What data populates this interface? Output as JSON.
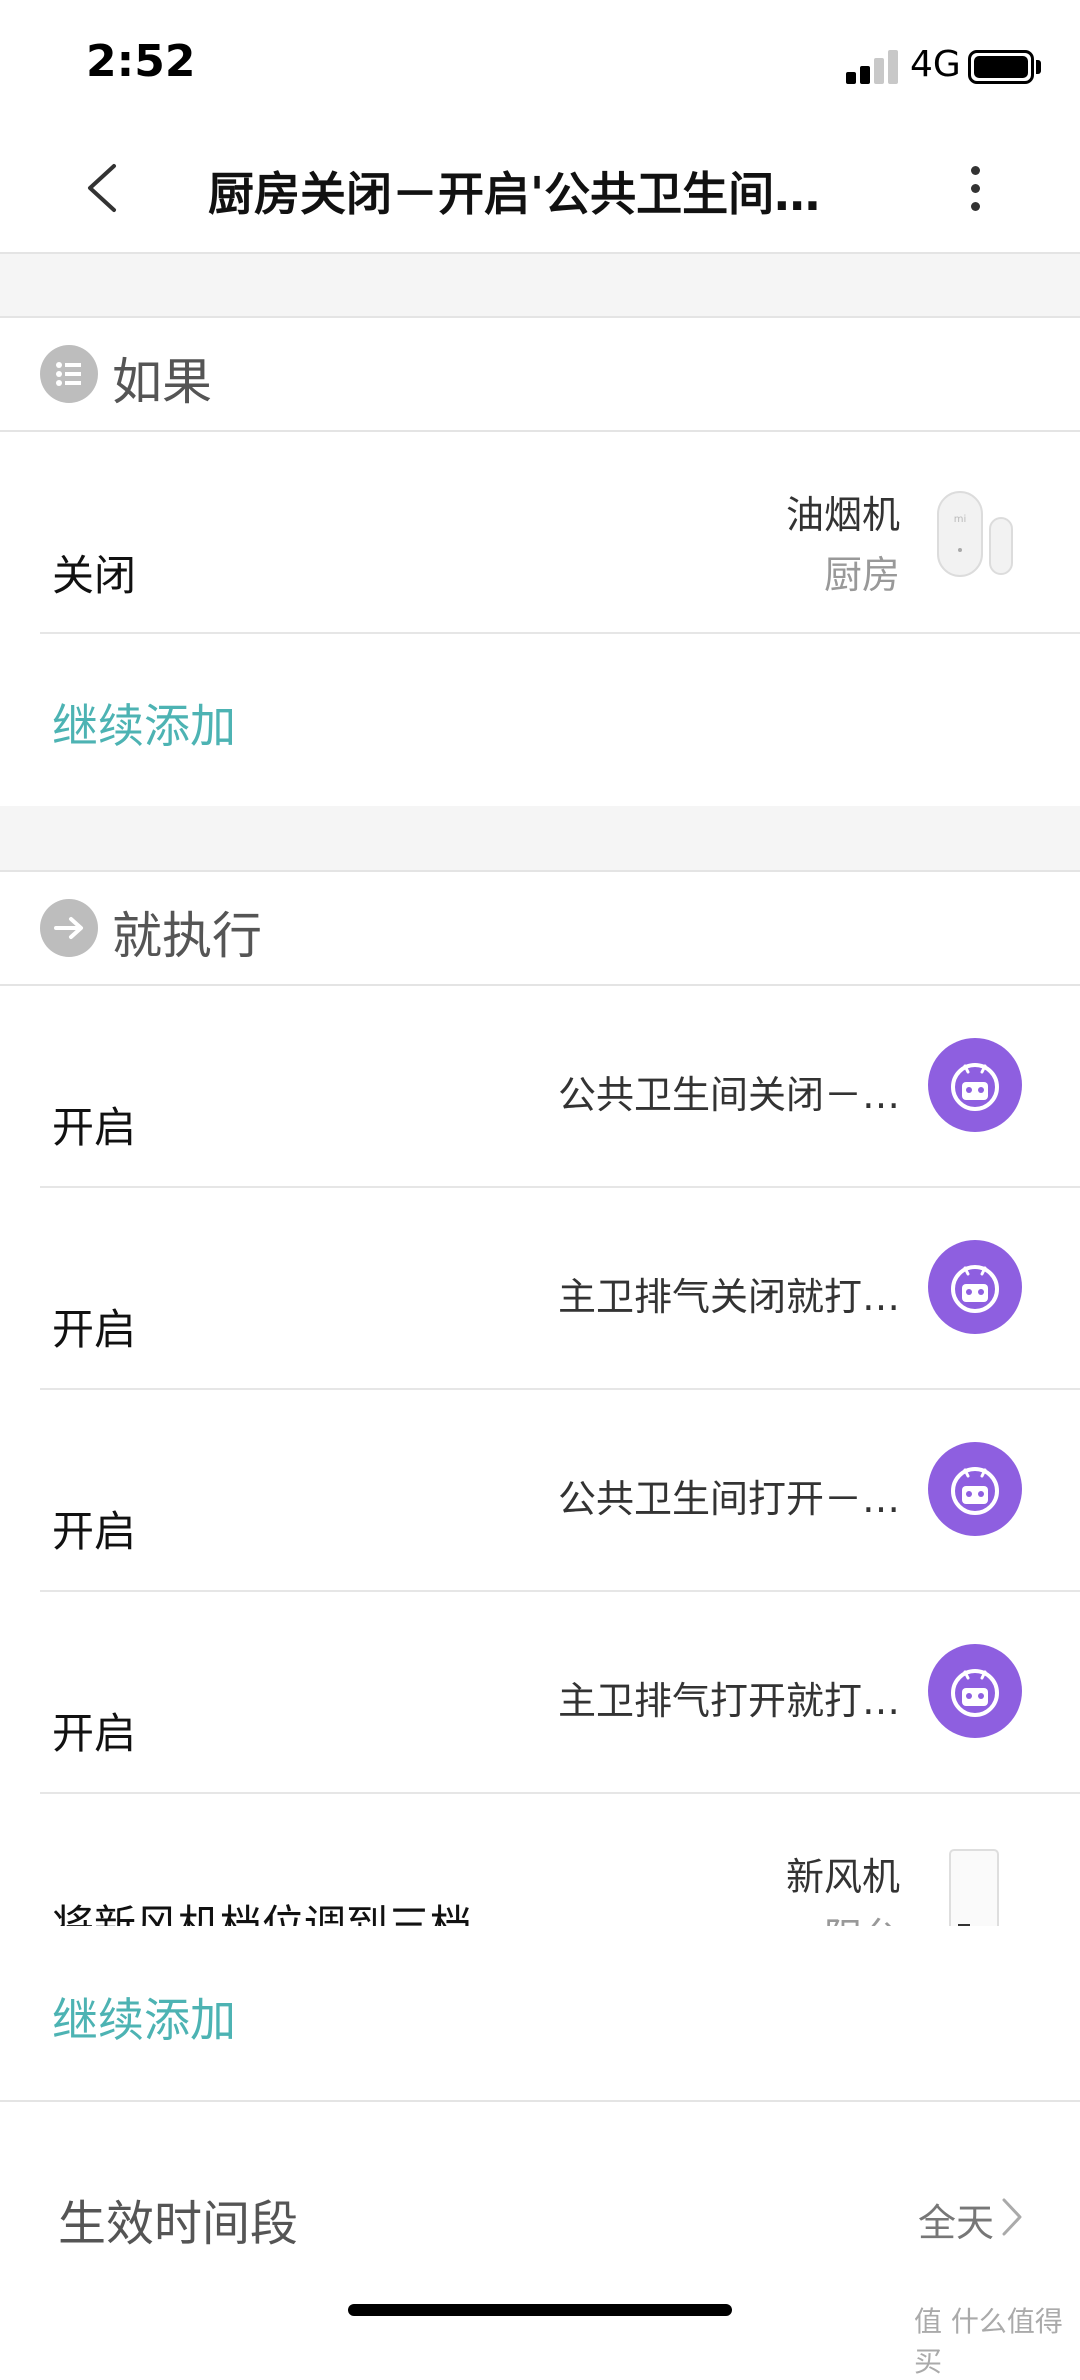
{
  "status_bar": {
    "time": "2:52",
    "network": "4G"
  },
  "header": {
    "title": "厨房关闭－开启'公共卫生间…"
  },
  "if_section": {
    "label": "如果",
    "icon": "list-icon",
    "rows": [
      {
        "action": "关闭",
        "device": "油烟机",
        "room": "厨房",
        "icon": "door-sensor-icon"
      }
    ],
    "add_label": "继续添加"
  },
  "then_section": {
    "label": "就执行",
    "icon": "arrow-right-icon",
    "rows": [
      {
        "action": "开启",
        "device": "公共卫生间关闭－…",
        "icon": "robot-icon"
      },
      {
        "action": "开启",
        "device": "主卫排气关闭就打…",
        "icon": "robot-icon"
      },
      {
        "action": "开启",
        "device": "公共卫生间打开－…",
        "icon": "robot-icon"
      },
      {
        "action": "开启",
        "device": "主卫排气打开就打…",
        "icon": "robot-icon"
      },
      {
        "action": "将新风机档位调到三档",
        "device": "新风机",
        "room": "阳台",
        "icon": "air-purifier-icon"
      }
    ],
    "add_label": "继续添加"
  },
  "effective_time": {
    "label": "生效时间段",
    "value": "全天"
  },
  "watermark": "值 什么值得买",
  "colors": {
    "accent": "#4db3b3",
    "robot": "#8e5fe0",
    "section_icon": "#bdbdbd"
  }
}
